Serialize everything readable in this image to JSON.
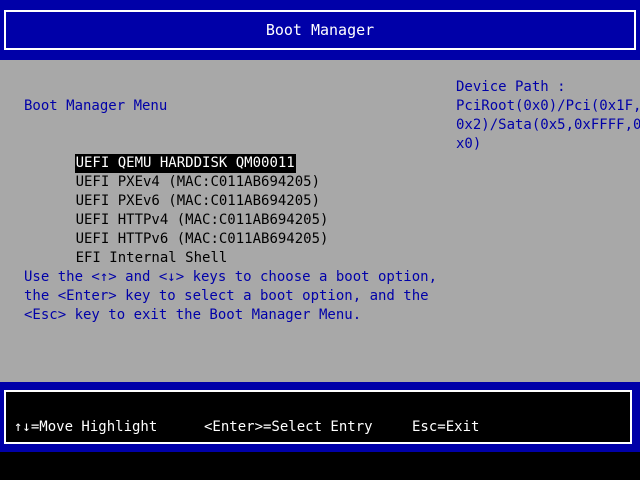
{
  "header": {
    "title": "Boot Manager"
  },
  "menu": {
    "title": "Boot Manager Menu",
    "options": [
      {
        "label": "UEFI QEMU HARDDISK QM00011",
        "selected": true
      },
      {
        "label": "UEFI PXEv4 (MAC:C011AB694205)",
        "selected": false
      },
      {
        "label": "UEFI PXEv6 (MAC:C011AB694205)",
        "selected": false
      },
      {
        "label": "UEFI HTTPv4 (MAC:C011AB694205)",
        "selected": false
      },
      {
        "label": "UEFI HTTPv6 (MAC:C011AB694205)",
        "selected": false
      },
      {
        "label": "EFI Internal Shell",
        "selected": false
      }
    ]
  },
  "help": {
    "lines": [
      "Use the <↑> and <↓> keys to choose a boot option,",
      "the <Enter> key to select a boot option, and the",
      "<Esc> key to exit the Boot Manager Menu."
    ]
  },
  "device_path": {
    "lines": [
      "Device Path :",
      "PciRoot(0x0)/Pci(0x1F,",
      "0x2)/Sata(0x5,0xFFFF,0",
      "x0)"
    ]
  },
  "footer": {
    "move_icon": "↑↓",
    "move": "=Move Highlight",
    "select": "<Enter>=Select Entry",
    "exit": "Esc=Exit"
  },
  "colors": {
    "bar": "#0000a8",
    "panel": "#a8a8a8",
    "text_blue": "#0000a8",
    "highlight_bg": "#000000",
    "highlight_fg": "#ffffff"
  }
}
